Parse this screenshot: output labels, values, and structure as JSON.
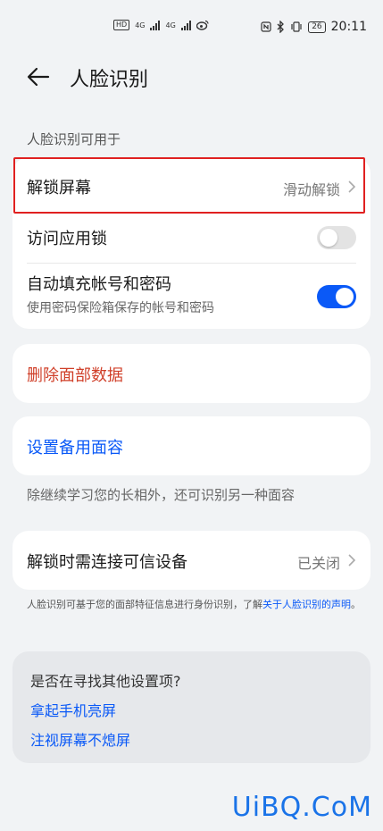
{
  "status_bar": {
    "left_indicators": [
      "HD",
      "4G",
      "4G"
    ],
    "time": "20:11",
    "battery": "26"
  },
  "header": {
    "title": "人脸识别"
  },
  "section_label": "人脸识别可用于",
  "unlock_card": {
    "unlock_screen": {
      "label": "解锁屏幕",
      "value": "滑动解锁"
    },
    "app_lock": {
      "label": "访问应用锁",
      "toggle": "off"
    },
    "autofill": {
      "label": "自动填充帐号和密码",
      "sub": "使用密码保险箱保存的帐号和密码",
      "toggle": "on"
    }
  },
  "delete_face": {
    "label": "删除面部数据",
    "color": "#d0402a"
  },
  "alt_face": {
    "label": "设置备用面容",
    "note": "除继续学习您的长相外，还可识别另一种面容"
  },
  "trusted_device": {
    "label": "解锁时需连接可信设备",
    "value": "已关闭"
  },
  "disclaimer": {
    "text": "人脸识别可基于您的面部特征信息进行身份识别，了解",
    "link": "关于人脸识别的声明",
    "end": "。"
  },
  "suggestions": {
    "title": "是否在寻找其他设置项?",
    "items": [
      "拿起手机亮屏",
      "注视屏幕不熄屏"
    ]
  },
  "watermark": "UiBQ.CoM",
  "colors": {
    "accent": "#0a59f7",
    "danger": "#d0402a",
    "highlight": "#e02020"
  }
}
